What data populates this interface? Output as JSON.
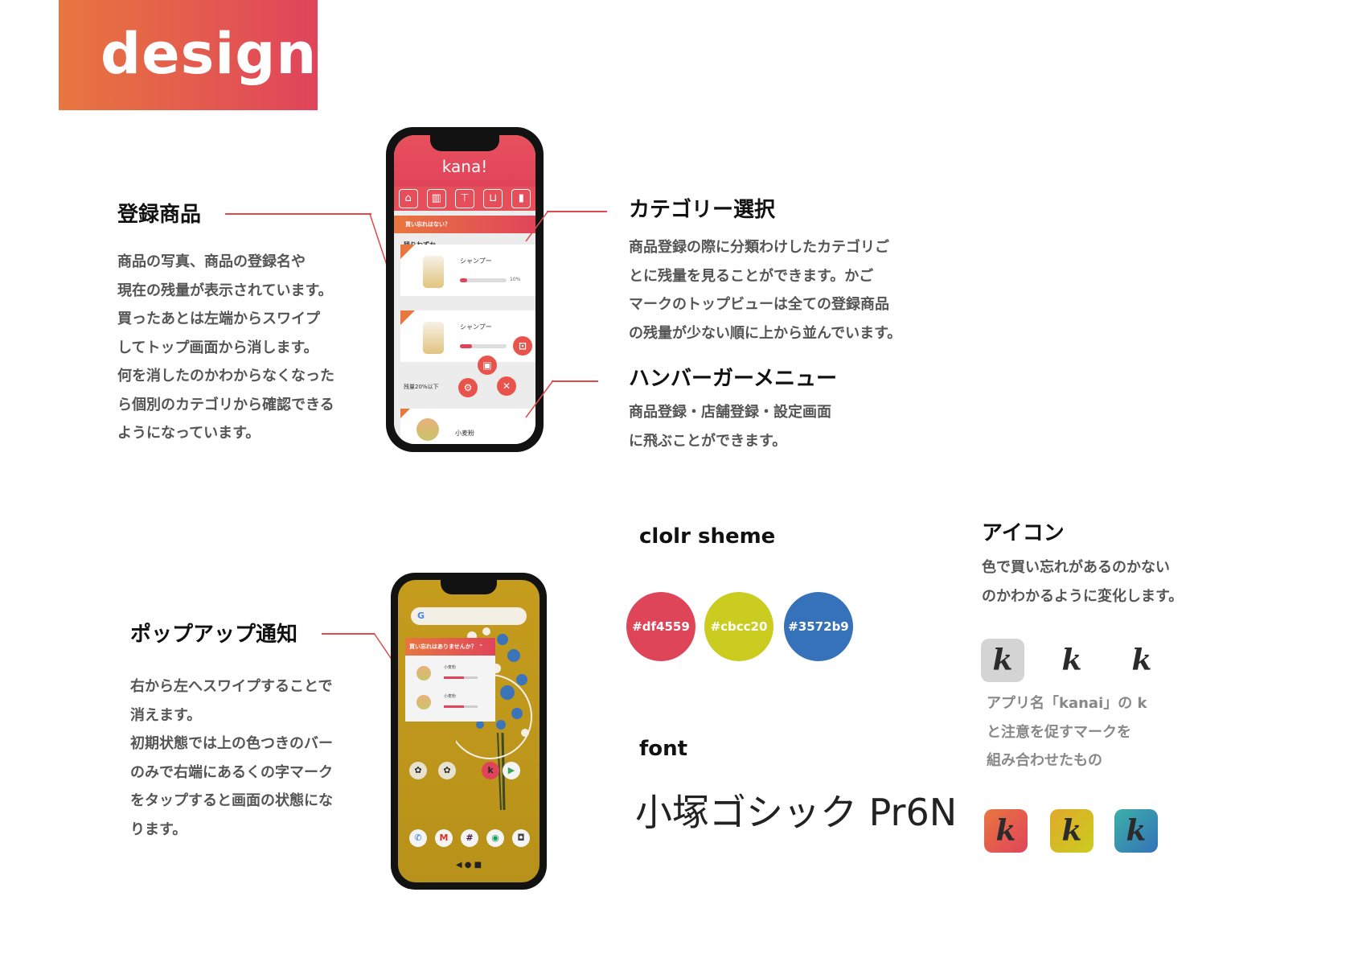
{
  "banner": {
    "title": "design"
  },
  "sections": {
    "registered": {
      "heading": "登録商品",
      "body": "商品の写真、商品の登録名や\n現在の残量が表示されています。\n買ったあとは左端からスワイプ\nしてトップ画面から消します。\n何を消したのかわからなくなった\nら個別のカテゴリから確認できる\nようになっています。"
    },
    "category": {
      "heading": "カテゴリー選択",
      "body": "商品登録の際に分類わけしたカテゴリご\nとに残量を見ることができます。かご\nマークのトップビューは全ての登録商品\nの残量が少ない順に上から並んでいます。"
    },
    "hamburger": {
      "heading": "ハンバーガーメニュー",
      "body": "商品登録・店舗登録・設定画面\nに飛ぶことができます。"
    },
    "popup": {
      "heading": "ポップアップ通知",
      "body": "右から左へスワイプすることで\n消えます。\n初期状態では上の色つきのバー\nのみで右端にあるくの字マーク\nをタップすると画面の状態にな\nります。"
    },
    "color_scheme": {
      "heading": "clolr sheme",
      "swatches": [
        "#df4559",
        "#cbcc20",
        "#3572b9"
      ]
    },
    "font": {
      "heading": "font",
      "sample": "小塚ゴシック Pr6N"
    },
    "icon": {
      "heading": "アイコン",
      "body": "色で買い忘れがあるのかない\nのかわかるように変化します。",
      "caption": "アプリ名「kanai」の k\nと注意を促すマークを\n組み合わせたもの",
      "glyph": "k"
    }
  },
  "phone1": {
    "logo": "kana!",
    "reminder": "買い忘れはない？",
    "section_low": "残りわずか",
    "items": [
      {
        "name": "シャンプー",
        "percent_label": "10%",
        "level": 0.1
      },
      {
        "name": "シャンプー",
        "level": 0.25
      }
    ],
    "section_20": "残量20%以下",
    "last_item": "小麦粉"
  },
  "phone2": {
    "notif_title": "買い忘れはありませんか？ ⌃",
    "items": [
      {
        "name": "小麦粉"
      },
      {
        "name": "小麦粉"
      }
    ],
    "nav": "◀   ●   ■"
  }
}
